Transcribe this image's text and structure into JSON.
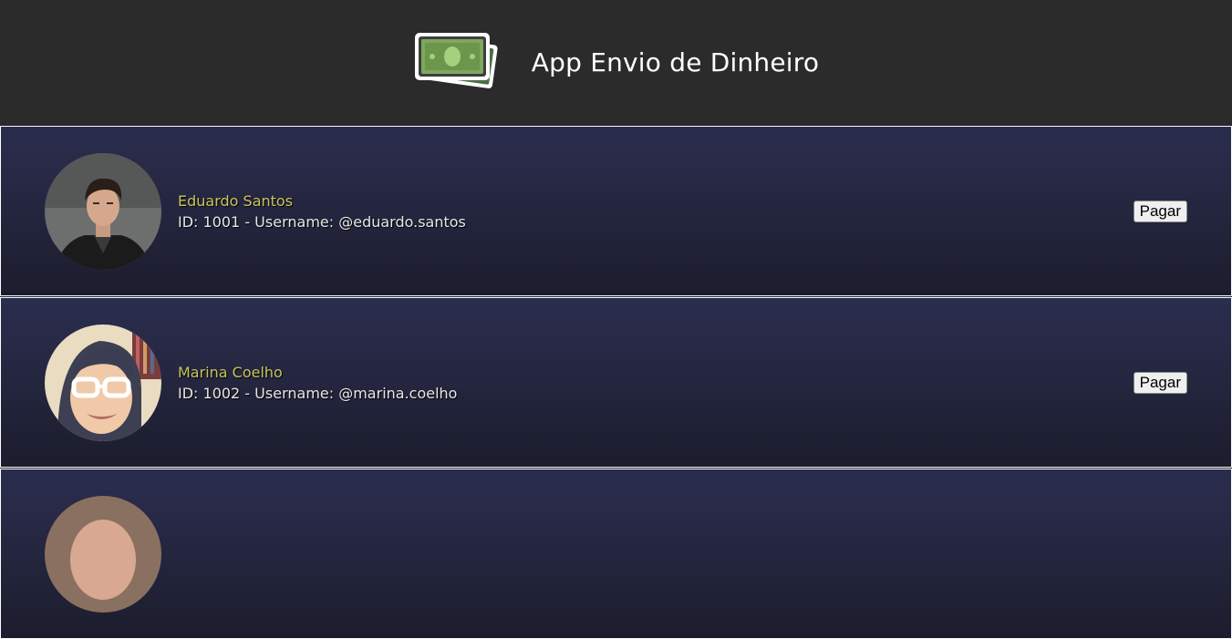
{
  "header": {
    "title": "App Envio de Dinheiro",
    "logo_icon": "money-bills-icon"
  },
  "users": [
    {
      "name": "Eduardo Santos",
      "meta": "ID: 1001 - Username: @eduardo.santos",
      "button_label": "Pagar"
    },
    {
      "name": "Marina Coelho",
      "meta": "ID: 1002 - Username: @marina.coelho",
      "button_label": "Pagar"
    }
  ],
  "colors": {
    "header_bg": "#2b2b2b",
    "row_bg_top": "#2b2d4e",
    "row_bg_bottom": "#1b1c2c",
    "name_color": "#c8c45f",
    "meta_color": "#e6e6e6"
  }
}
